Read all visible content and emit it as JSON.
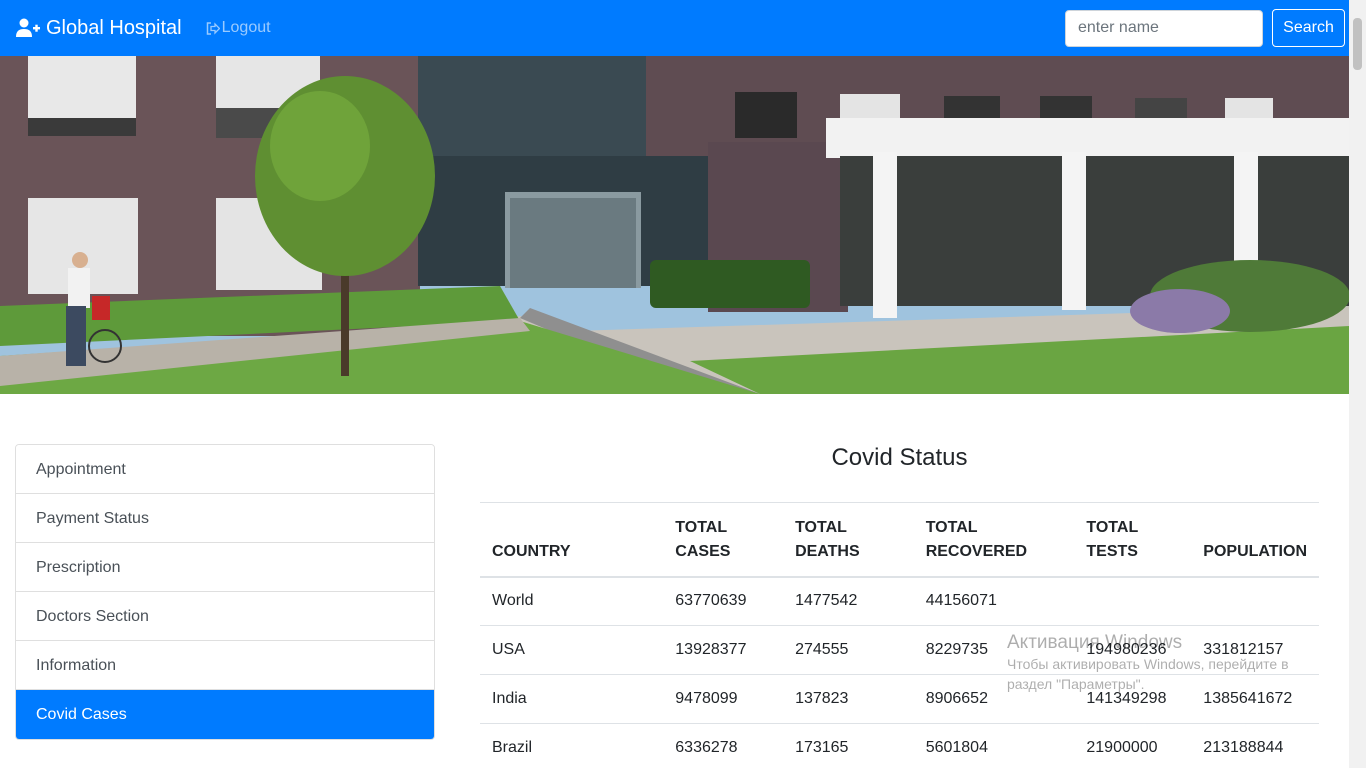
{
  "navbar": {
    "brand": "Global Hospital",
    "logout": "Logout",
    "search_placeholder": "enter name",
    "search_button": "Search"
  },
  "sidebar": {
    "items": [
      {
        "label": "Appointment"
      },
      {
        "label": "Payment Status"
      },
      {
        "label": "Prescription"
      },
      {
        "label": "Doctors Section"
      },
      {
        "label": "Information"
      },
      {
        "label": "Covid Cases",
        "active": true
      }
    ]
  },
  "covid": {
    "title": "Covid Status",
    "headers": [
      "COUNTRY",
      "TOTAL CASES",
      "TOTAL DEATHS",
      "TOTAL RECOVERED",
      "TOTAL TESTS",
      "POPULATION"
    ],
    "rows": [
      [
        "World",
        "63770639",
        "1477542",
        "44156071",
        "",
        ""
      ],
      [
        "USA",
        "13928377",
        "274555",
        "8229735",
        "194980236",
        "331812157"
      ],
      [
        "India",
        "9478099",
        "137823",
        "8906652",
        "141349298",
        "1385641672"
      ],
      [
        "Brazil",
        "6336278",
        "173165",
        "5601804",
        "21900000",
        "213188844"
      ]
    ]
  },
  "watermark": {
    "line1": "Активация Windows",
    "line2": "Чтобы активировать Windows, перейдите в раздел \"Параметры\"."
  },
  "colors": {
    "primary": "#007bff",
    "navbar_bg": "#007bff"
  }
}
